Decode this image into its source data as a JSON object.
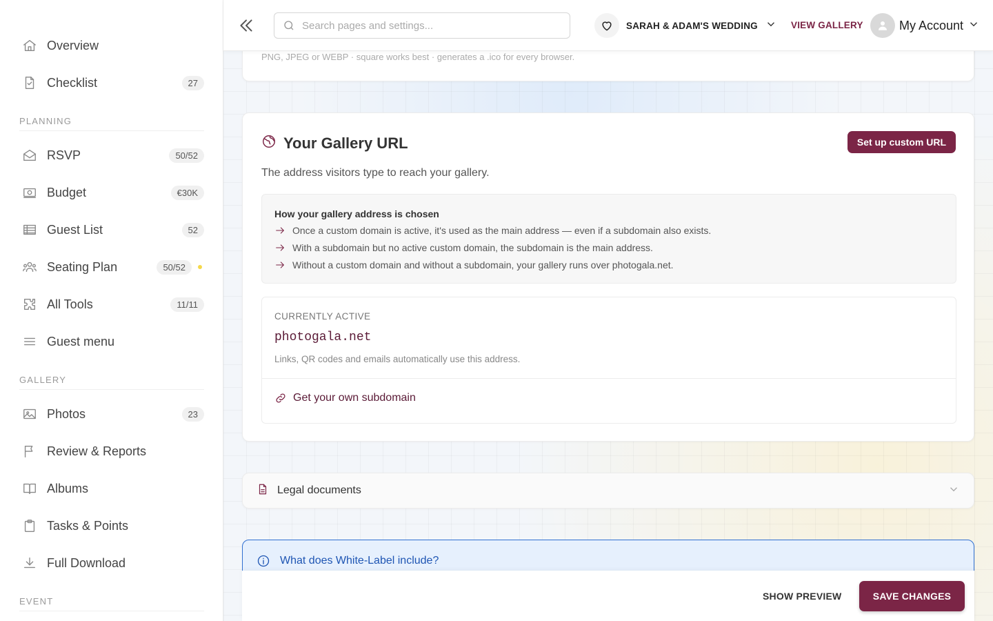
{
  "sidebar": {
    "items": [
      {
        "label": "Overview",
        "icon": "home-icon",
        "badge": ""
      },
      {
        "label": "Checklist",
        "icon": "checklist-icon",
        "badge": "27"
      },
      {
        "label": "RSVP",
        "icon": "envelope-icon",
        "badge": "50/52"
      },
      {
        "label": "Budget",
        "icon": "money-icon",
        "badge": "€30K"
      },
      {
        "label": "Guest List",
        "icon": "table-icon",
        "badge": "52"
      },
      {
        "label": "Seating Plan",
        "icon": "people-icon",
        "badge": "50/52"
      },
      {
        "label": "All Tools",
        "icon": "puzzle-icon",
        "badge": "11/11"
      },
      {
        "label": "Guest menu",
        "icon": "menu-icon",
        "badge": ""
      },
      {
        "label": "Photos",
        "icon": "image-icon",
        "badge": "23"
      },
      {
        "label": "Review & Reports",
        "icon": "flag-icon",
        "badge": ""
      },
      {
        "label": "Albums",
        "icon": "book-icon",
        "badge": ""
      },
      {
        "label": "Tasks & Points",
        "icon": "clipboard-icon",
        "badge": ""
      },
      {
        "label": "Full Download",
        "icon": "download-icon",
        "badge": ""
      }
    ],
    "sections": {
      "planning": "PLANNING",
      "gallery": "GALLERY",
      "event": "EVENT"
    }
  },
  "topbar": {
    "search_placeholder": "Search pages and settings...",
    "event_name": "SARAH & ADAM'S WEDDING",
    "view_gallery": "VIEW GALLERY",
    "account_label": "My Account"
  },
  "main": {
    "favicon_hint": "PNG, JPEG or WEBP · square works best · generates a .ico for every browser.",
    "gallery_url": {
      "title": "Your Gallery URL",
      "custom_url_button": "Set up custom URL",
      "description": "The address visitors type to reach your gallery.",
      "how_title": "How your gallery address is chosen",
      "how_items": [
        "Once a custom domain is active, it's used as the main address — even if a subdomain also exists.",
        "With a subdomain but no active custom domain, the subdomain is the main address.",
        "Without a custom domain and without a subdomain, your gallery runs over photogala.net."
      ],
      "active_label": "CURRENTLY ACTIVE",
      "active_domain": "photogala.net",
      "active_note": "Links, QR codes and emails automatically use this address.",
      "subdomain_link": "Get your own subdomain"
    },
    "legal_documents": "Legal documents",
    "white_label_question": "What does White-Label include?"
  },
  "footer": {
    "show_preview": "SHOW PREVIEW",
    "save_changes": "SAVE CHANGES"
  },
  "colors": {
    "brand": "#7b2546",
    "info": "#1e55b3",
    "badge_dot": "#f5d84a"
  }
}
